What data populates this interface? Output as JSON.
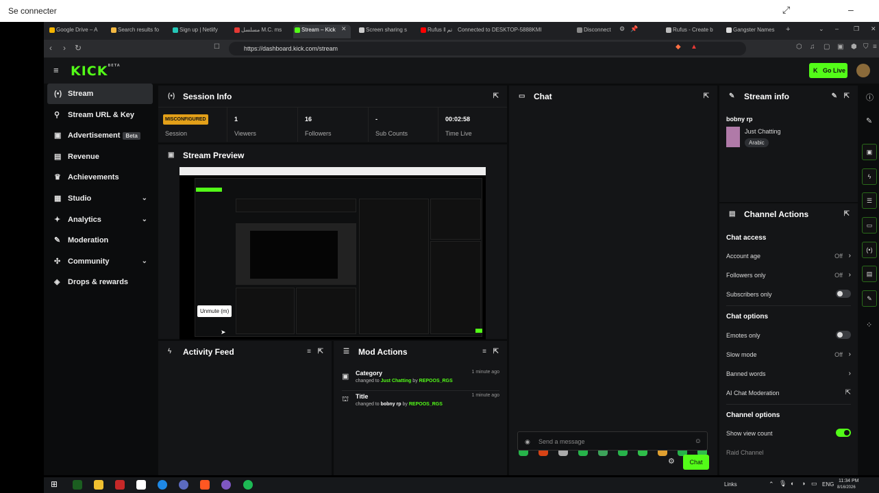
{
  "outer": {
    "title": "Se connecter"
  },
  "browser": {
    "tabs": [
      {
        "label": "Google Drive – A",
        "color": "#f4b400"
      },
      {
        "label": "Search results fo",
        "color": "#f5b942"
      },
      {
        "label": "Sign up | Netlify",
        "color": "#25c7b7"
      },
      {
        "label": "مسلسل M.C. ms",
        "color": "#e53935"
      },
      {
        "label": "Stream – Kick",
        "color": "#53fc18"
      },
      {
        "label": "Screen sharing s",
        "color": "#cccccc"
      },
      {
        "label": "Rufus ‖ تم",
        "color": "#ff0000"
      },
      {
        "label": "Connected to DESKTOP-5888KMI",
        "color": "#1f2023"
      },
      {
        "label": "Disconnect",
        "color": "#1f2023"
      },
      {
        "label": "Rufus - Create b",
        "color": "#bbbbbb"
      },
      {
        "label": "Gangster Names",
        "color": "#dddddd"
      }
    ],
    "url": "https://dashboard.kick.com/stream"
  },
  "app": {
    "logo": "KICK",
    "logo_tag": "BETA",
    "go_live": "Go Live"
  },
  "sidebar": {
    "items": [
      {
        "label": "Stream",
        "icon": "broadcast-icon"
      },
      {
        "label": "Stream URL & Key",
        "icon": "link-icon"
      },
      {
        "label": "Advertisement",
        "icon": "ad-icon",
        "badge": "Beta"
      },
      {
        "label": "Revenue",
        "icon": "chart-icon"
      },
      {
        "label": "Achievements",
        "icon": "trophy-icon"
      },
      {
        "label": "Studio",
        "icon": "studio-icon"
      },
      {
        "label": "Analytics",
        "icon": "analytics-icon"
      },
      {
        "label": "Moderation",
        "icon": "wrench-icon"
      },
      {
        "label": "Community",
        "icon": "community-icon"
      },
      {
        "label": "Drops & rewards",
        "icon": "gift-icon"
      }
    ]
  },
  "session": {
    "title": "Session Info",
    "status": "MISCONFIGURED",
    "status_label": "Session",
    "viewers": "1",
    "viewers_label": "Viewers",
    "followers": "16",
    "followers_label": "Followers",
    "subs": "-",
    "subs_label": "Sub Counts",
    "time": "00:02:58",
    "time_label": "Time Live"
  },
  "preview": {
    "title": "Stream Preview",
    "tooltip": "Unmute (m)"
  },
  "activity": {
    "title": "Activity Feed"
  },
  "mod": {
    "title": "Mod Actions",
    "rows": [
      {
        "title": "Category",
        "time": "1 minute ago",
        "prefix": "changed to",
        "value": "Just Chatting",
        "by": "by",
        "user": "REPOOS_RGS"
      },
      {
        "title": "Title",
        "time": "1 minute ago",
        "prefix": "changed to",
        "value": "bobny rp",
        "by": "by",
        "user": "REPOOS_RGS"
      }
    ]
  },
  "chat": {
    "title": "Chat",
    "placeholder": "Send a message",
    "send": "Chat"
  },
  "stream_info": {
    "title": "Stream info",
    "stream_title": "bobny rp",
    "category": "Just Chatting",
    "tag": "Arabic"
  },
  "channel_actions": {
    "title": "Channel Actions",
    "chat_access": "Chat access",
    "account_age": "Account age",
    "account_age_val": "Off",
    "followers_only": "Followers only",
    "followers_only_val": "Off",
    "subscribers_only": "Subscribers only",
    "chat_options": "Chat options",
    "emotes_only": "Emotes only",
    "slow_mode": "Slow mode",
    "slow_mode_val": "Off",
    "banned_words": "Banned words",
    "ai_mod": "AI Chat Moderation",
    "channel_options": "Channel options",
    "show_view_count": "Show view count",
    "raid_channel": "Raid Channel"
  },
  "taskbar": {
    "links": "Links",
    "lang": "ENG",
    "time": "11:34 PM",
    "date": "8/16/2026"
  }
}
